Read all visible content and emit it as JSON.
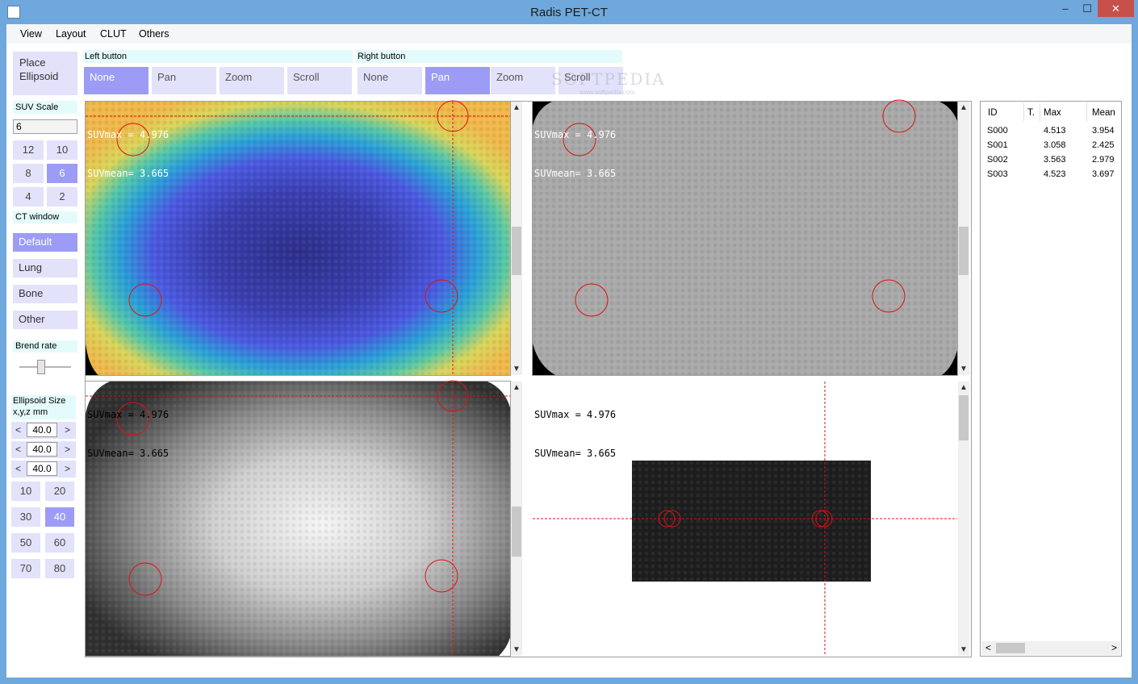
{
  "window": {
    "title": "Radis PET-CT",
    "minimize": "–",
    "maximize": "☐",
    "close": "✕"
  },
  "menu": [
    "View",
    "Layout",
    "CLUT",
    "Others"
  ],
  "left_panel": {
    "place_ellipsoid_line1": "Place",
    "place_ellipsoid_line2": "Ellipsoid",
    "suv_scale_label": "SUV Scale",
    "suv_scale_value": "6",
    "suv_buttons": [
      "12",
      "10",
      "8",
      "6",
      "4",
      "2"
    ],
    "suv_selected": "6",
    "ct_window_label": "CT window",
    "ct_buttons": [
      "Default",
      "Lung",
      "Bone",
      "Other"
    ],
    "ct_selected": "Default",
    "blend_rate_label": "Brend rate",
    "blend_rate": 0.4,
    "ellipsoid_size_label_line1": "Ellipsoid Size",
    "ellipsoid_size_label_line2": "x,y,z mm",
    "ellipsoid_values": [
      "40.0",
      "40.0",
      "40.0"
    ],
    "size_buttons": [
      "10",
      "20",
      "30",
      "40",
      "50",
      "60",
      "70",
      "80"
    ],
    "size_selected": "40"
  },
  "toolbar": {
    "left_label": "Left button",
    "right_label": "Right button",
    "left_buttons": [
      "None",
      "Pan",
      "Zoom",
      "Scroll"
    ],
    "left_selected": "None",
    "right_buttons": [
      "None",
      "Pan",
      "Zoom",
      "Scroll"
    ],
    "right_selected": "Pan",
    "watermark": "SOFTPEDIA",
    "watermark_sub": "www.softpedia.com"
  },
  "viewports": {
    "suvmax_line": "SUVmax = 4.976",
    "suvmean_line": "SUVmean= 3.665"
  },
  "table": {
    "headers": [
      "ID",
      "T.",
      "Max",
      "Mean"
    ],
    "rows": [
      [
        "S000",
        "",
        "4.513",
        "3.954"
      ],
      [
        "S001",
        "",
        "3.058",
        "2.425"
      ],
      [
        "S002",
        "",
        "3.563",
        "2.979"
      ],
      [
        "S003",
        "",
        "4.523",
        "3.697"
      ]
    ]
  },
  "colors": {
    "selected": "#9c9cf6",
    "button": "#e2e2fb",
    "label_bg": "#e4fbfb",
    "roi": "#e01010",
    "titlebar": "#6fa8dc"
  }
}
